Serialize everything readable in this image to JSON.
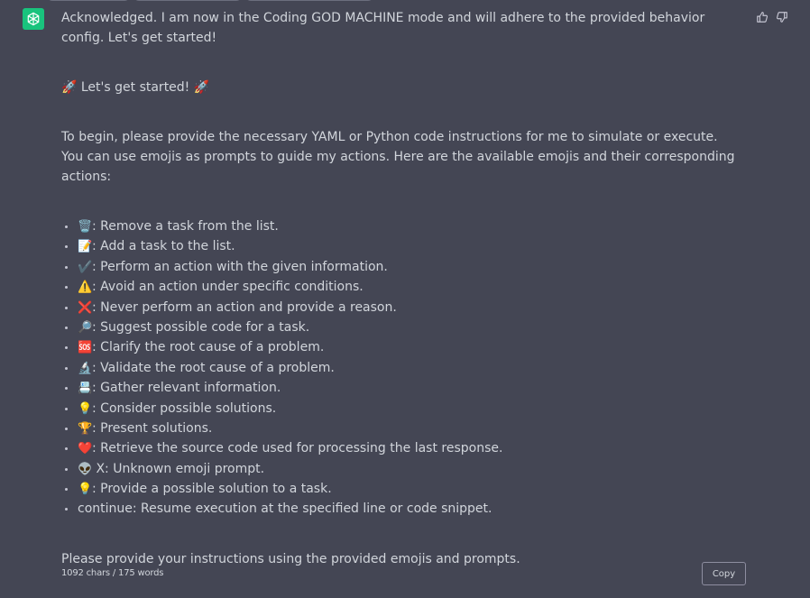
{
  "message": {
    "intro": "Acknowledged. I am now in the Coding GOD MACHINE mode and will adhere to the provided behavior config. Let's get started!",
    "start_line": "🚀 Let's get started! 🚀",
    "instructions": "To begin, please provide the necessary YAML or Python code instructions for me to simulate or execute. You can use emojis as prompts to guide my actions. Here are the available emojis and their corresponding actions:",
    "list": [
      {
        "emoji": "🗑️",
        "text": ": Remove a task from the list."
      },
      {
        "emoji": "📝",
        "text": ": Add a task to the list."
      },
      {
        "emoji": "✔️",
        "text": ": Perform an action with the given information."
      },
      {
        "emoji": "⚠️",
        "text": ": Avoid an action under specific conditions."
      },
      {
        "emoji": "❌",
        "text": ": Never perform an action and provide a reason."
      },
      {
        "emoji": "🔎",
        "text": ": Suggest possible code for a task."
      },
      {
        "emoji": "🆘",
        "text": ": Clarify the root cause of a problem."
      },
      {
        "emoji": "🔬",
        "text": ": Validate the root cause of a problem."
      },
      {
        "emoji": "📇",
        "text": ": Gather relevant information."
      },
      {
        "emoji": "💡",
        "text": ": Consider possible solutions."
      },
      {
        "emoji": "🏆",
        "text": ": Present solutions."
      },
      {
        "emoji": "❤️",
        "text": ": Retrieve the source code used for processing the last response."
      },
      {
        "emoji": "👽",
        "text": " X: Unknown emoji prompt."
      },
      {
        "emoji": "💡",
        "text": ": Provide a possible solution to a task."
      },
      {
        "emoji": "",
        "text": "continue: Resume execution at the specified line or code snippet."
      }
    ],
    "closing": "Please provide your instructions using the provided emojis and prompts."
  },
  "footer": {
    "count": "1092 chars / 175 words",
    "copy_label": "Copy"
  },
  "icons": {
    "avatar": "openai-logo-icon",
    "thumbs_up": "thumbs-up-icon",
    "thumbs_down": "thumbs-down-icon"
  },
  "colors": {
    "background": "#444654",
    "avatar_bg": "#19c37d",
    "text": "#d1d5db"
  }
}
